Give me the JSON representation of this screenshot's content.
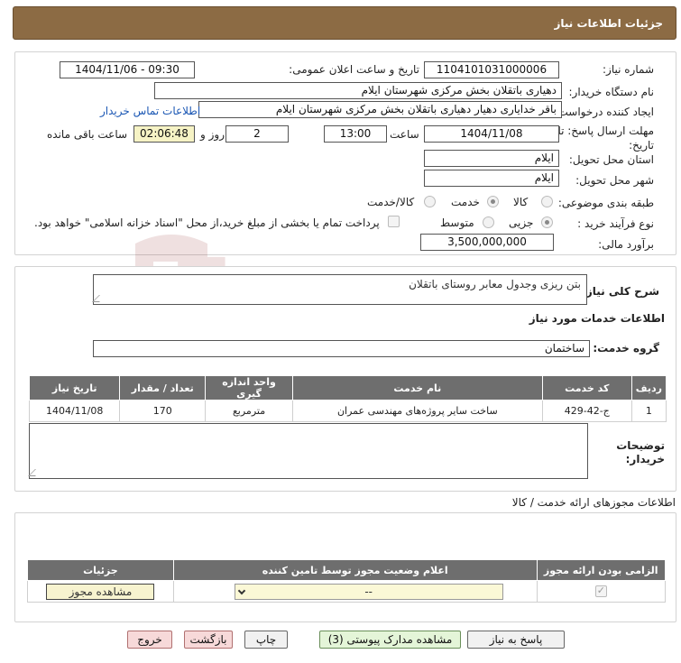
{
  "header": {
    "title": "جزئیات اطلاعات نیاز"
  },
  "info": {
    "need_number_label": "شماره نیاز:",
    "need_number": "1104101031000006",
    "announce_label": "تاریخ و ساعت اعلان عمومی:",
    "announce_value": "1404/11/06 - 09:30",
    "buyer_label": "نام دستگاه خریدار:",
    "buyer_value": "دهیاری باتقلان بخش مرکزی شهرستان ایلام",
    "creator_label": "ایجاد کننده درخواست:",
    "creator_value": "باقر خدایاری دهیار دهیاری باتقلان بخش مرکزی شهرستان ایلام",
    "contact_link": "اطلاعات تماس خریدار",
    "deadline_label": "مهلت ارسال پاسخ: تا تاریخ:",
    "deadline_date": "1404/11/08",
    "time_label": "ساعت",
    "deadline_time": "13:00",
    "days_value": "2",
    "days_label": "روز و",
    "remaining_value": "02:06:48",
    "remaining_label": "ساعت باقی مانده",
    "province_label": "استان محل تحویل:",
    "province_value": "ایلام",
    "city_label": "شهر محل تحویل:",
    "city_value": "ایلام",
    "category_label": "طبقه بندی موضوعی:",
    "category_options": [
      "کالا",
      "خدمت",
      "کالا/خدمت"
    ],
    "category_selected": "خدمت",
    "process_label": "نوع فرآیند خرید :",
    "process_options": [
      "جزیی",
      "متوسط"
    ],
    "process_selected": "جزیی",
    "payment_note": "پرداخت تمام یا بخشی از مبلغ خرید،از محل \"اسناد خزانه اسلامی\" خواهد بود.",
    "estimate_label": "برآورد مالی:",
    "estimate_value": "3,500,000,000"
  },
  "description": {
    "label": "شرح کلی نیاز:",
    "value": "بتن ریزی وجدول معابر روستای باتقلان"
  },
  "services": {
    "title": "اطلاعات خدمات مورد نیاز",
    "group_label": "گروه خدمت:",
    "group_value": "ساختمان",
    "columns": [
      "ردیف",
      "کد خدمت",
      "نام خدمت",
      "واحد اندازه گیری",
      "تعداد / مقدار",
      "تاریخ نیاز"
    ],
    "rows": [
      [
        "1",
        "ج-42-429",
        "ساخت سایر پروژه‌های مهندسی عمران",
        "مترمربع",
        "170",
        "1404/11/08"
      ]
    ]
  },
  "buyer_notes": {
    "label": "توضیحات خریدار:"
  },
  "permits": {
    "title": "اطلاعات مجوزهای ارائه خدمت / کالا",
    "columns": [
      "الزامی بودن ارائه مجوز",
      "اعلام وضعیت مجوز توسط تامین کننده",
      "جزئیات"
    ],
    "select_value": "--",
    "view_button": "مشاهده مجوز"
  },
  "actions": {
    "reply": "پاسخ به نیاز",
    "attachments": "مشاهده مدارک پیوستی (3)",
    "print": "چاپ",
    "back": "بازگشت",
    "exit": "خروج"
  },
  "watermark": {
    "text": "AriaTender.neT"
  }
}
